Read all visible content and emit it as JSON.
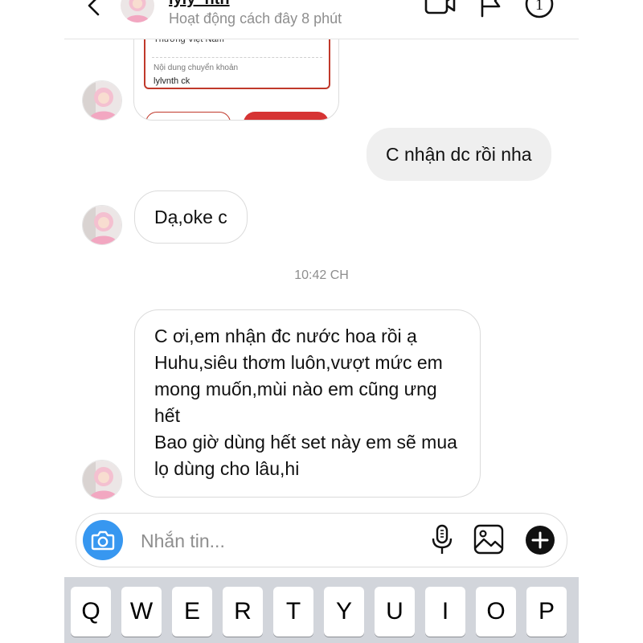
{
  "header": {
    "username": "lyly_nth",
    "status": "Hoạt động cách đây 8 phút",
    "notification_count": "1"
  },
  "shared_card": {
    "line1": "Thương Việt Nam",
    "label": "Nội dung chuyển khoản",
    "value": "lylvnth ck"
  },
  "messages": [
    {
      "from": "me",
      "text": "C nhận dc rồi nha"
    },
    {
      "from": "them",
      "text": "Dạ,oke c"
    },
    {
      "from": "them",
      "lines": [
        "C ơi,em nhận đc nước hoa rồi ạ",
        "Huhu,siêu thơm luôn,vượt mức em",
        "mong muốn,mùi nào em cũng ưng",
        "hết",
        "Bao giờ dùng hết set này em sẽ mua",
        "lọ dùng cho lâu,hi"
      ]
    }
  ],
  "timestamp": "10:42 CH",
  "composer": {
    "placeholder": "Nhắn tin..."
  },
  "keyboard": {
    "keys": [
      "Q",
      "W",
      "E",
      "R",
      "T",
      "Y",
      "U",
      "I",
      "O",
      "P"
    ]
  },
  "colors": {
    "accent": "#3797f0",
    "bank_red": "#d63333",
    "outgoing_bubble": "#efefef"
  },
  "icons": [
    "back-arrow-icon",
    "video-call-icon",
    "flag-icon",
    "info-icon",
    "camera-icon",
    "microphone-icon",
    "gallery-icon",
    "plus-icon"
  ]
}
